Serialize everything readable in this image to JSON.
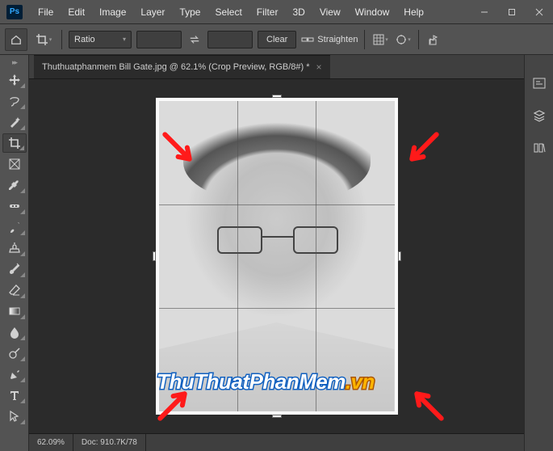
{
  "app": {
    "logo": "Ps"
  },
  "menu": [
    "File",
    "Edit",
    "Image",
    "Layer",
    "Type",
    "Select",
    "Filter",
    "3D",
    "View",
    "Window",
    "Help"
  ],
  "opt": {
    "ratio_label": "Ratio",
    "clear_label": "Clear",
    "straighten_label": "Straighten"
  },
  "tab": {
    "title": "Thuthuatphanmem Bill Gate.jpg @ 62.1% (Crop Preview, RGB/8#) *"
  },
  "status": {
    "zoom": "62.09%",
    "doc": "Doc: 910.7K/78"
  },
  "watermark": {
    "main": "ThuThuatPhanMem",
    "suffix": ".vn"
  }
}
